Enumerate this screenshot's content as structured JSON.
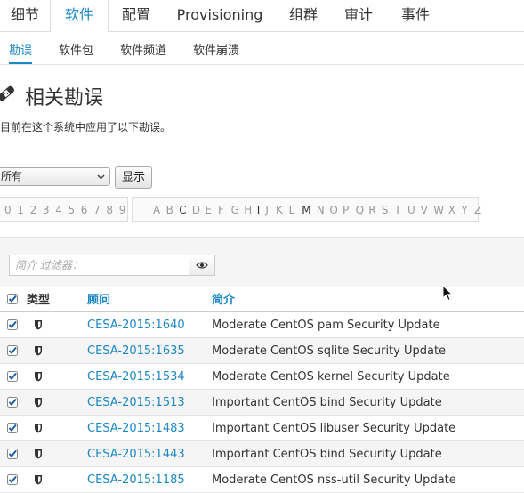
{
  "nav": {
    "tabs": [
      {
        "label": "细节",
        "active": false
      },
      {
        "label": "软件",
        "active": true
      },
      {
        "label": "配置",
        "active": false
      },
      {
        "label": "Provisioning",
        "active": false
      },
      {
        "label": "组群",
        "active": false
      },
      {
        "label": "审计",
        "active": false
      },
      {
        "label": "事件",
        "active": false
      }
    ],
    "subtabs": [
      {
        "label": "勘误",
        "active": true
      },
      {
        "label": "软件包",
        "active": false
      },
      {
        "label": "软件频道",
        "active": false
      },
      {
        "label": "软件崩溃",
        "active": false
      }
    ]
  },
  "page": {
    "title": "相关勘误",
    "title_icon": "bandage-icon",
    "subtitle": "目前在这个系统中应用了以下勘误。"
  },
  "filter": {
    "select_value": "所有",
    "show_button": "显示",
    "digits": [
      "0",
      "1",
      "2",
      "3",
      "4",
      "5",
      "6",
      "7",
      "8",
      "9"
    ],
    "letters": [
      "A",
      "B",
      "C",
      "D",
      "E",
      "F",
      "G",
      "H",
      "I",
      "J",
      "K",
      "L",
      "M",
      "N",
      "O",
      "P",
      "Q",
      "R",
      "S",
      "T",
      "U",
      "V",
      "W",
      "X",
      "Y",
      "Z"
    ],
    "active_letters": [
      "C",
      "I",
      "M"
    ],
    "search_placeholder": "简介 过滤器："
  },
  "table": {
    "headers": {
      "type": "类型",
      "advisory": "顾问",
      "synopsis": "简介"
    },
    "rows": [
      {
        "advisory": "CESA-2015:1640",
        "synopsis": "Moderate CentOS pam Security Update",
        "checked": true
      },
      {
        "advisory": "CESA-2015:1635",
        "synopsis": "Moderate CentOS sqlite Security Update",
        "checked": true
      },
      {
        "advisory": "CESA-2015:1534",
        "synopsis": "Moderate CentOS kernel Security Update",
        "checked": true
      },
      {
        "advisory": "CESA-2015:1513",
        "synopsis": "Important CentOS bind Security Update",
        "checked": true
      },
      {
        "advisory": "CESA-2015:1483",
        "synopsis": "Important CentOS libuser Security Update",
        "checked": true
      },
      {
        "advisory": "CESA-2015:1443",
        "synopsis": "Important CentOS bind Security Update",
        "checked": true
      },
      {
        "advisory": "CESA-2015:1185",
        "synopsis": "Moderate CentOS nss-util Security Update",
        "checked": true
      }
    ]
  },
  "colors": {
    "accent": "#1b87c4",
    "text": "#333333",
    "muted": "#999999"
  }
}
